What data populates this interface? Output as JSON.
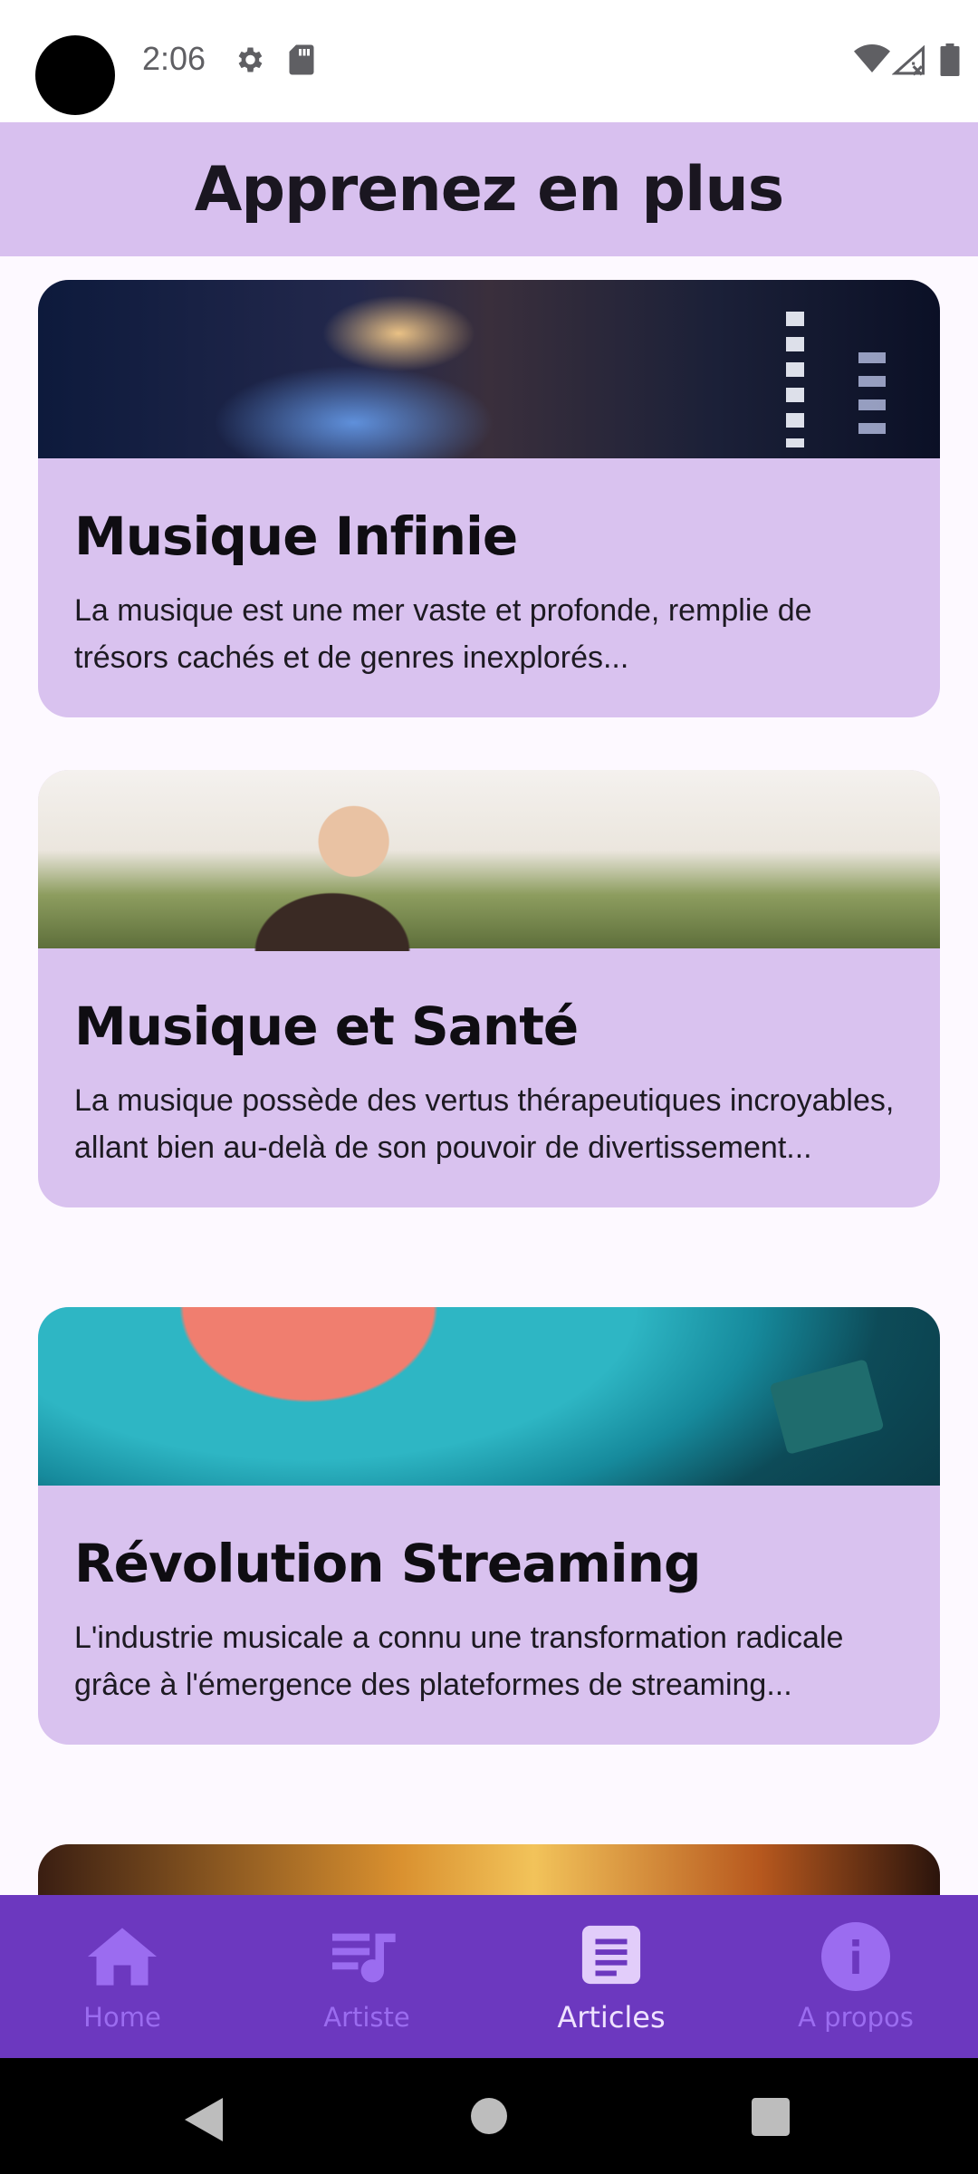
{
  "status_bar": {
    "time": "2:06",
    "icons": [
      "camera-cutout",
      "gear-icon",
      "sd-card-icon",
      "wifi-icon",
      "signal-icon",
      "battery-icon"
    ]
  },
  "app_bar": {
    "title": "Apprenez en plus"
  },
  "articles": [
    {
      "title": "Musique Infinie",
      "description": "La musique est une mer vaste et profonde, remplie de trésors cachés et de genres inexplorés...",
      "image": "concert-stage-lights"
    },
    {
      "title": "Musique et Santé",
      "description": "La musique possède des vertus thérapeutiques incroyables, allant bien au-delà de son pouvoir de divertissement...",
      "image": "woman-with-headphones"
    },
    {
      "title": "Révolution Streaming",
      "description": "L'industrie musicale a connu une transformation radicale grâce à l'émergence des plateformes de streaming...",
      "image": "vinyl-record"
    },
    {
      "image": "concert-crowd"
    }
  ],
  "bottom_nav": {
    "items": [
      {
        "label": "Home",
        "icon": "home-icon",
        "active": false
      },
      {
        "label": "Artiste",
        "icon": "music-list-icon",
        "active": false
      },
      {
        "label": "Articles",
        "icon": "article-icon",
        "active": true
      },
      {
        "label": "A propos",
        "icon": "info-icon",
        "active": false
      }
    ]
  },
  "colors": {
    "app_bar_bg": "#d8c0ef",
    "card_bg": "#d9c2ef",
    "bottom_nav_bg": "#6c38bf",
    "nav_inactive": "#9b6cf0",
    "nav_active": "#efe2ff"
  }
}
